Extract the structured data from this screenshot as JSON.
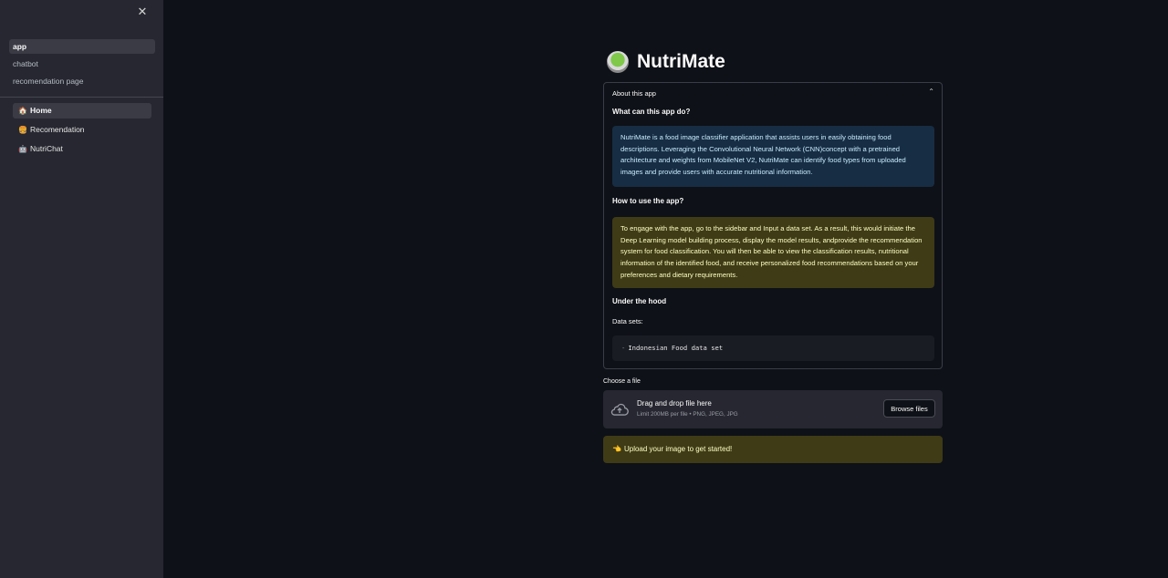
{
  "sidebar": {
    "close_glyph": "✕",
    "pages": [
      {
        "label": "app",
        "active": true
      },
      {
        "label": "chatbot",
        "active": false
      },
      {
        "label": "recomendation page",
        "active": false
      }
    ],
    "menu": [
      {
        "label": "Home",
        "icon": "house-icon",
        "glyph": "🏠"
      },
      {
        "label": "Recomendation",
        "icon": "burger-icon",
        "glyph": "🍔"
      },
      {
        "label": "NutriChat",
        "icon": "robot-icon",
        "glyph": "🤖"
      }
    ]
  },
  "main": {
    "title": "NutriMate",
    "title_icon": "salad-bowl-icon",
    "expander": {
      "header": "About this app",
      "chevron": "⌃",
      "what_heading": "What can this app do?",
      "what_text": "NutriMate is a food image classifier application that assists users in easily obtaining food descriptions. Leveraging the Convolutional Neural Network (CNN)concept with a pretrained architecture and weights from MobileNet V2, NutriMate can identify food types from uploaded images and provide users with accurate nutritional information.",
      "how_heading": "How to use the app?",
      "how_text": "To engage with the app, go to the sidebar and Input a data set. As a result, this would initiate the Deep Learning model building process, display the model results, andprovide the recommendation system for food classification. You will then be able to view the classification results, nutritional information of the identified food, and receive personalized food recommendations based on your preferences and dietary requirements.",
      "hood_heading": "Under the hood",
      "datasets_label": "Data sets:",
      "dataset_item": "Indonesian Food data set"
    },
    "uploader": {
      "label": "Choose a file",
      "drop_title": "Drag and drop file here",
      "limit": "Limit 200MB per file • PNG, JPEG, JPG",
      "button": "Browse files"
    },
    "alert": {
      "text": "Upload your image to get started!",
      "icon": "pointing-hand-icon"
    }
  },
  "colors": {
    "background": "#0e1117",
    "sidebar": "#262730",
    "info_blue": "#172d43",
    "warning_yellow": "#3e3b16"
  }
}
